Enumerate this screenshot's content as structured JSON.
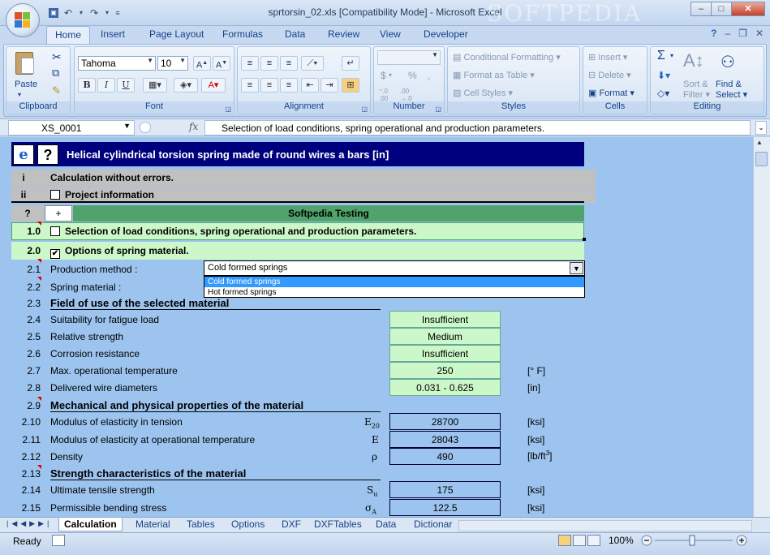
{
  "window": {
    "title": "sprtorsin_02.xls  [Compatibility Mode] - Microsoft Excel",
    "watermark": "SOFTPEDIA",
    "min": "–",
    "max": "□",
    "close": "✕"
  },
  "ribbon_tabs": [
    "Home",
    "Insert",
    "Page Layout",
    "Formulas",
    "Data",
    "Review",
    "View",
    "Developer"
  ],
  "clipboard": {
    "paste": "Paste",
    "label": "Clipboard"
  },
  "font": {
    "family": "Tahoma",
    "size": "10",
    "label": "Font",
    "bold": "B",
    "italic": "I",
    "underline": "U"
  },
  "alignment": {
    "label": "Alignment"
  },
  "number": {
    "label": "Number",
    "currency": "$",
    "percent": "%",
    "comma": ","
  },
  "styles": {
    "conditional": "Conditional Formatting",
    "table": "Format as Table",
    "cell": "Cell Styles",
    "label": "Styles"
  },
  "cells": {
    "insert": "Insert",
    "delete": "Delete",
    "format": "Format",
    "label": "Cells"
  },
  "editing": {
    "sum": "Σ",
    "sort": "Sort &",
    "sort2": "Filter",
    "find": "Find &",
    "find2": "Select",
    "label": "Editing"
  },
  "formula_bar": {
    "name_box": "XS_0001",
    "fx": "fx",
    "content": "Selection of load conditions, spring operational and production parameters."
  },
  "sheet": {
    "header_title": "Helical cylindrical torsion spring made of round wires a bars [in]",
    "row_i": {
      "num": "i",
      "label": "Calculation without errors."
    },
    "row_ii": {
      "num": "ii",
      "label": "Project information"
    },
    "row_q": {
      "num": "?",
      "plus": "+",
      "label": "Softpedia Testing"
    },
    "row_10": {
      "num": "1.0",
      "label": "Selection of load conditions, spring operational and production parameters."
    },
    "row_20": {
      "num": "2.0",
      "label": "Options of spring material."
    },
    "row_21": {
      "num": "2.1",
      "label": "Production method :",
      "dropdown_value": "Cold formed springs"
    },
    "dropdown_options": [
      "Cold formed springs",
      "Hot formed springs"
    ],
    "row_22": {
      "num": "2.2",
      "label": "Spring material :"
    },
    "row_23": {
      "num": "2.3",
      "label": "Field of use of the selected material"
    },
    "row_24": {
      "num": "2.4",
      "label": "Suitability for fatigue load",
      "value": "Insufficient"
    },
    "row_25": {
      "num": "2.5",
      "label": "Relative strength",
      "value": "Medium"
    },
    "row_26": {
      "num": "2.6",
      "label": "Corrosion resistance",
      "value": "Insufficient"
    },
    "row_27": {
      "num": "2.7",
      "label": "Max. operational temperature",
      "value": "250",
      "unit": "[° F]"
    },
    "row_28": {
      "num": "2.8",
      "label": "Delivered wire diameters",
      "value": "0.031 - 0.625",
      "unit": "[in]"
    },
    "row_29": {
      "num": "2.9",
      "label": "Mechanical and physical properties of the material"
    },
    "row_210": {
      "num": "2.10",
      "label": "Modulus of elasticity in tension",
      "symbol": "E",
      "sub": "20",
      "value": "28700",
      "unit": "[ksi]"
    },
    "row_211": {
      "num": "2.11",
      "label": "Modulus of elasticity at operational temperature",
      "symbol": "E",
      "value": "28043",
      "unit": "[ksi]"
    },
    "row_212": {
      "num": "2.12",
      "label": "Density",
      "symbol": "ρ",
      "value": "490",
      "unit": "[lb/ft",
      "unit_sup": "3",
      "unit_end": "]"
    },
    "row_213": {
      "num": "2.13",
      "label": "Strength characteristics of the material"
    },
    "row_214": {
      "num": "2.14",
      "label": "Ultimate tensile strength",
      "symbol": "S",
      "sub": "u",
      "value": "175",
      "unit": "[ksi]"
    },
    "row_215": {
      "num": "2.15",
      "label": "Permissible bending stress",
      "symbol": "σ",
      "sub": "A",
      "value": "122.5",
      "unit": "[ksi]"
    }
  },
  "sheet_tabs": [
    "Calculation",
    "Material",
    "Tables",
    "Options",
    "DXF",
    "DXFTables",
    "Data",
    "Dictionar"
  ],
  "status": {
    "ready": "Ready",
    "zoom": "100%"
  },
  "colors": {
    "sheet_bg": "#9cc4ef",
    "header_bg": "#00007f",
    "green_band": "#4fa36b",
    "light_green": "#ccf7c8",
    "gray_row": "#c0c0c0"
  }
}
